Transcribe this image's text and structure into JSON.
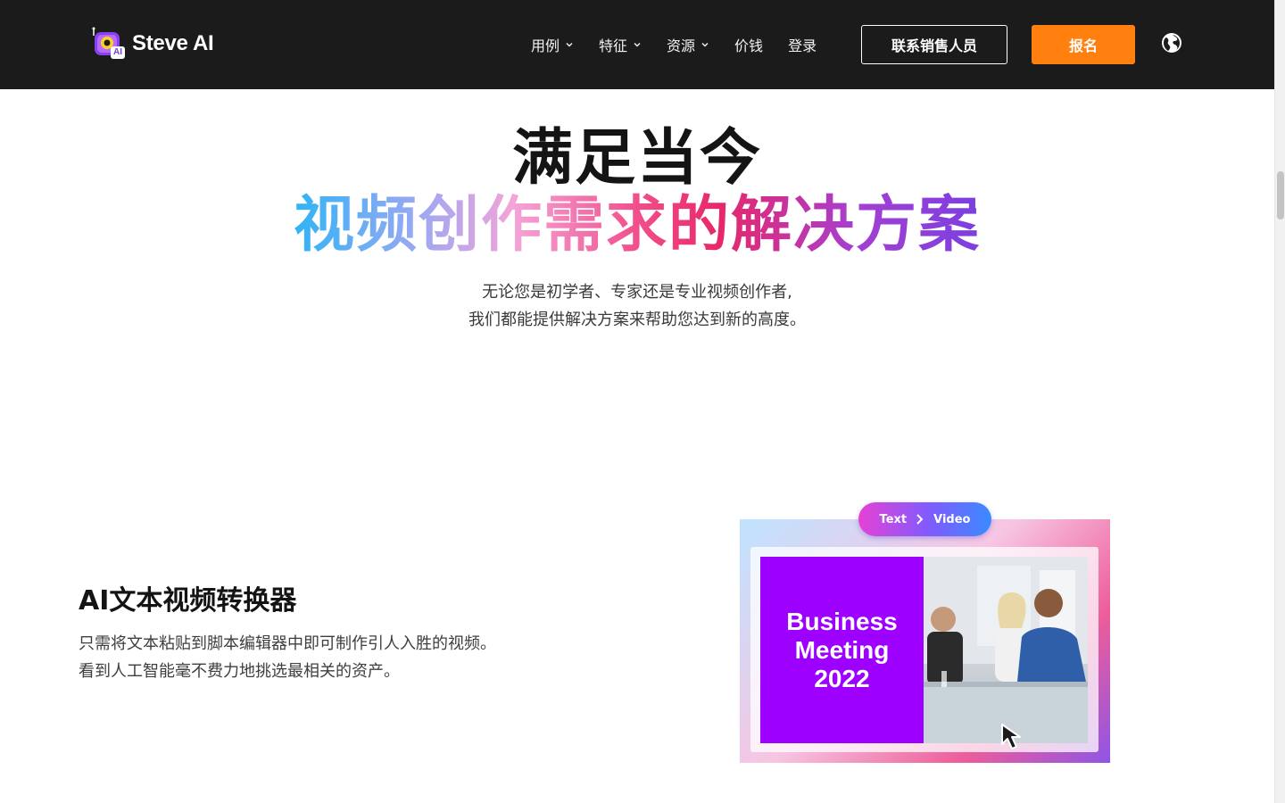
{
  "header": {
    "brand": "Steve AI",
    "logo_badge": "AI",
    "nav": [
      {
        "label": "用例",
        "has_dropdown": true
      },
      {
        "label": "特征",
        "has_dropdown": true
      },
      {
        "label": "资源",
        "has_dropdown": true
      },
      {
        "label": "价钱",
        "has_dropdown": false
      },
      {
        "label": "登录",
        "has_dropdown": false
      }
    ],
    "contact_button": "联系销售人员",
    "signup_button": "报名",
    "language_icon": "globe-icon"
  },
  "hero": {
    "title_line1": "满足当今",
    "title_line2": "视频创作需求的解决方案",
    "subtitle_line1": "无论您是初学者、专家还是专业视频创作者,",
    "subtitle_line2": "我们都能提供解决方案来帮助您达到新的高度。"
  },
  "feature": {
    "title": "AI文本视频转换器",
    "description": "只需将文本粘贴到脚本编辑器中即可制作引人入胜的视频。看到人工智能毫不费力地挑选最相关的资产。"
  },
  "illustration": {
    "pill_from": "Text",
    "pill_to": "Video",
    "card_line1": "Business",
    "card_line2": "Meeting",
    "card_line3": "2022"
  },
  "colors": {
    "header_bg": "#1b1b1b",
    "accent_orange": "#ff7f0f",
    "card_purple": "#9d00ff"
  }
}
